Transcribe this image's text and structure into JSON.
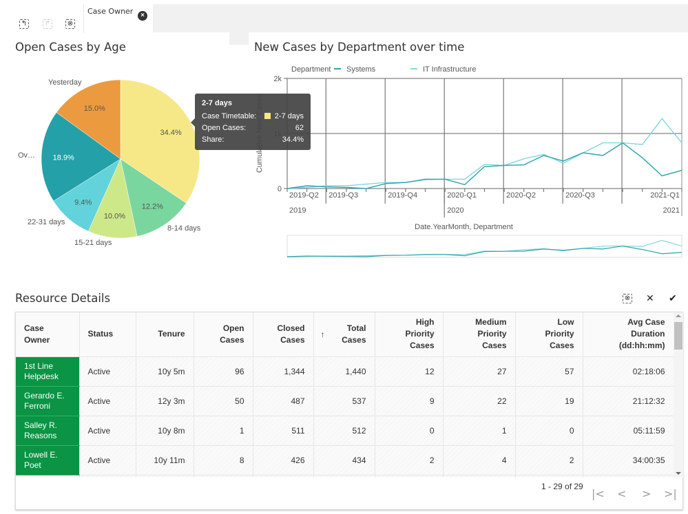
{
  "toolbar": {
    "undo_icon": "undo-icon",
    "redo_icon": "redo-icon",
    "clear_selection_icon": "clear-selection-icon"
  },
  "filter_tab": {
    "label": "Case Owner",
    "close_icon": "close-circle-icon"
  },
  "pie_widget": {
    "title": "Open Cases by Age",
    "tooltip": {
      "title": "2-7 days",
      "rows": [
        {
          "label": "Case Timetable:",
          "value": "2-7 days",
          "swatch": "#f6e886"
        },
        {
          "label": "Open Cases:",
          "value": "62"
        },
        {
          "label": "Share:",
          "value": "34.4%"
        }
      ]
    }
  },
  "line_widget": {
    "title": "New Cases by Department over time"
  },
  "chart_data": [
    {
      "type": "pie",
      "title": "Open Cases by Age",
      "slices": [
        {
          "label": "2-7 days",
          "share": 34.4,
          "value_label": "34.4%",
          "color": "#f6e886"
        },
        {
          "label": "8-14 days",
          "share": 12.2,
          "value_label": "12.2%",
          "color": "#7ad69f"
        },
        {
          "label": "15-21 days",
          "share": 10.0,
          "value_label": "10.0%",
          "color": "#cde888"
        },
        {
          "label": "22-31 days",
          "share": 9.4,
          "value_label": "9.4%",
          "color": "#62d3da"
        },
        {
          "label": "Ov…",
          "share": 18.9,
          "value_label": "18.9%",
          "color": "#24a0a8"
        },
        {
          "label": "Yesterday",
          "share": 15.0,
          "value_label": "15.0%",
          "color": "#ec9a3f"
        }
      ]
    },
    {
      "type": "line",
      "title": "New Cases by Department over time",
      "xlabel": "Date.YearMonth, Department",
      "ylabel": "Cumulative New Cases",
      "ylim": [
        0,
        2000
      ],
      "y_ticks": [
        "0",
        "1k",
        "2k"
      ],
      "legend_title": "Department",
      "legend_position": "top",
      "x_quarter_labels": [
        "2019-Q2",
        "2019-Q3",
        "2019-Q4",
        "2020-Q1",
        "2020-Q2",
        "2020-Q3",
        "2021-Q1"
      ],
      "x_year_labels": [
        "2019",
        "2020",
        "2021"
      ],
      "x": [
        "2019-04",
        "2019-05",
        "2019-06",
        "2019-07",
        "2019-08",
        "2019-09",
        "2019-10",
        "2019-11",
        "2019-12",
        "2020-01",
        "2020-02",
        "2020-03",
        "2020-04",
        "2020-05",
        "2020-06",
        "2020-07",
        "2020-08",
        "2020-09",
        "2020-10",
        "2020-11",
        "2020-12"
      ],
      "series": [
        {
          "name": "Systems",
          "color": "#2ba3a9",
          "values": [
            0,
            50,
            30,
            20,
            0,
            90,
            110,
            170,
            170,
            70,
            400,
            420,
            430,
            600,
            500,
            650,
            600,
            830,
            560,
            230,
            330
          ]
        },
        {
          "name": "IT Infrastructure",
          "color": "#7fd8e0",
          "values": [
            0,
            20,
            50,
            50,
            80,
            110,
            110,
            160,
            170,
            170,
            440,
            420,
            540,
            620,
            460,
            650,
            830,
            830,
            800,
            1270,
            830
          ]
        }
      ]
    }
  ],
  "table_widget": {
    "title": "Resource Details",
    "toolbar_icons": [
      "clear-selection-icon",
      "cancel-icon",
      "confirm-icon"
    ],
    "columns": [
      {
        "label_lines": [
          "Case",
          "Owner"
        ],
        "align": "left"
      },
      {
        "label_lines": [
          "Status"
        ],
        "align": "left"
      },
      {
        "label_lines": [
          "Tenure"
        ],
        "align": "right"
      },
      {
        "label_lines": [
          "Open",
          "Cases"
        ],
        "align": "right"
      },
      {
        "label_lines": [
          "Closed",
          "Cases"
        ],
        "align": "right"
      },
      {
        "label_lines": [
          "Total",
          "Cases"
        ],
        "align": "right",
        "sorted": "ascending"
      },
      {
        "label_lines": [
          "High",
          "Priority",
          "Cases"
        ],
        "align": "right"
      },
      {
        "label_lines": [
          "Medium",
          "Priority",
          "Cases"
        ],
        "align": "right"
      },
      {
        "label_lines": [
          "Low",
          "Priority",
          "Cases"
        ],
        "align": "right"
      },
      {
        "label_lines": [
          "Avg Case",
          "Duration",
          "(dd:hh:mm)"
        ],
        "align": "right"
      }
    ],
    "rows": [
      {
        "owner_lines": [
          "1st Line",
          "Helpdesk"
        ],
        "status": "Active",
        "tenure": "10y 5m",
        "open": "96",
        "closed": "1,344",
        "total": "1,440",
        "high": "12",
        "medium": "27",
        "low": "57",
        "duration": "02:18:06"
      },
      {
        "owner_lines": [
          "Gerardo E.",
          "Ferroni"
        ],
        "status": "Active",
        "tenure": "12y 3m",
        "open": "50",
        "closed": "487",
        "total": "537",
        "high": "9",
        "medium": "22",
        "low": "19",
        "duration": "21:12:32"
      },
      {
        "owner_lines": [
          "Salley R.",
          "Reasons"
        ],
        "status": "Active",
        "tenure": "10y 8m",
        "open": "1",
        "closed": "511",
        "total": "512",
        "high": "0",
        "medium": "1",
        "low": "0",
        "duration": "05:11:59"
      },
      {
        "owner_lines": [
          "Lowell E.",
          "Poet"
        ],
        "status": "Active",
        "tenure": "10y 11m",
        "open": "8",
        "closed": "426",
        "total": "434",
        "high": "2",
        "medium": "4",
        "low": "2",
        "duration": "34:00:35"
      }
    ],
    "pagination": {
      "info": "1 - 29 of 29",
      "first": "|<",
      "prev": "<",
      "next": ">",
      "last": ">|"
    }
  }
}
